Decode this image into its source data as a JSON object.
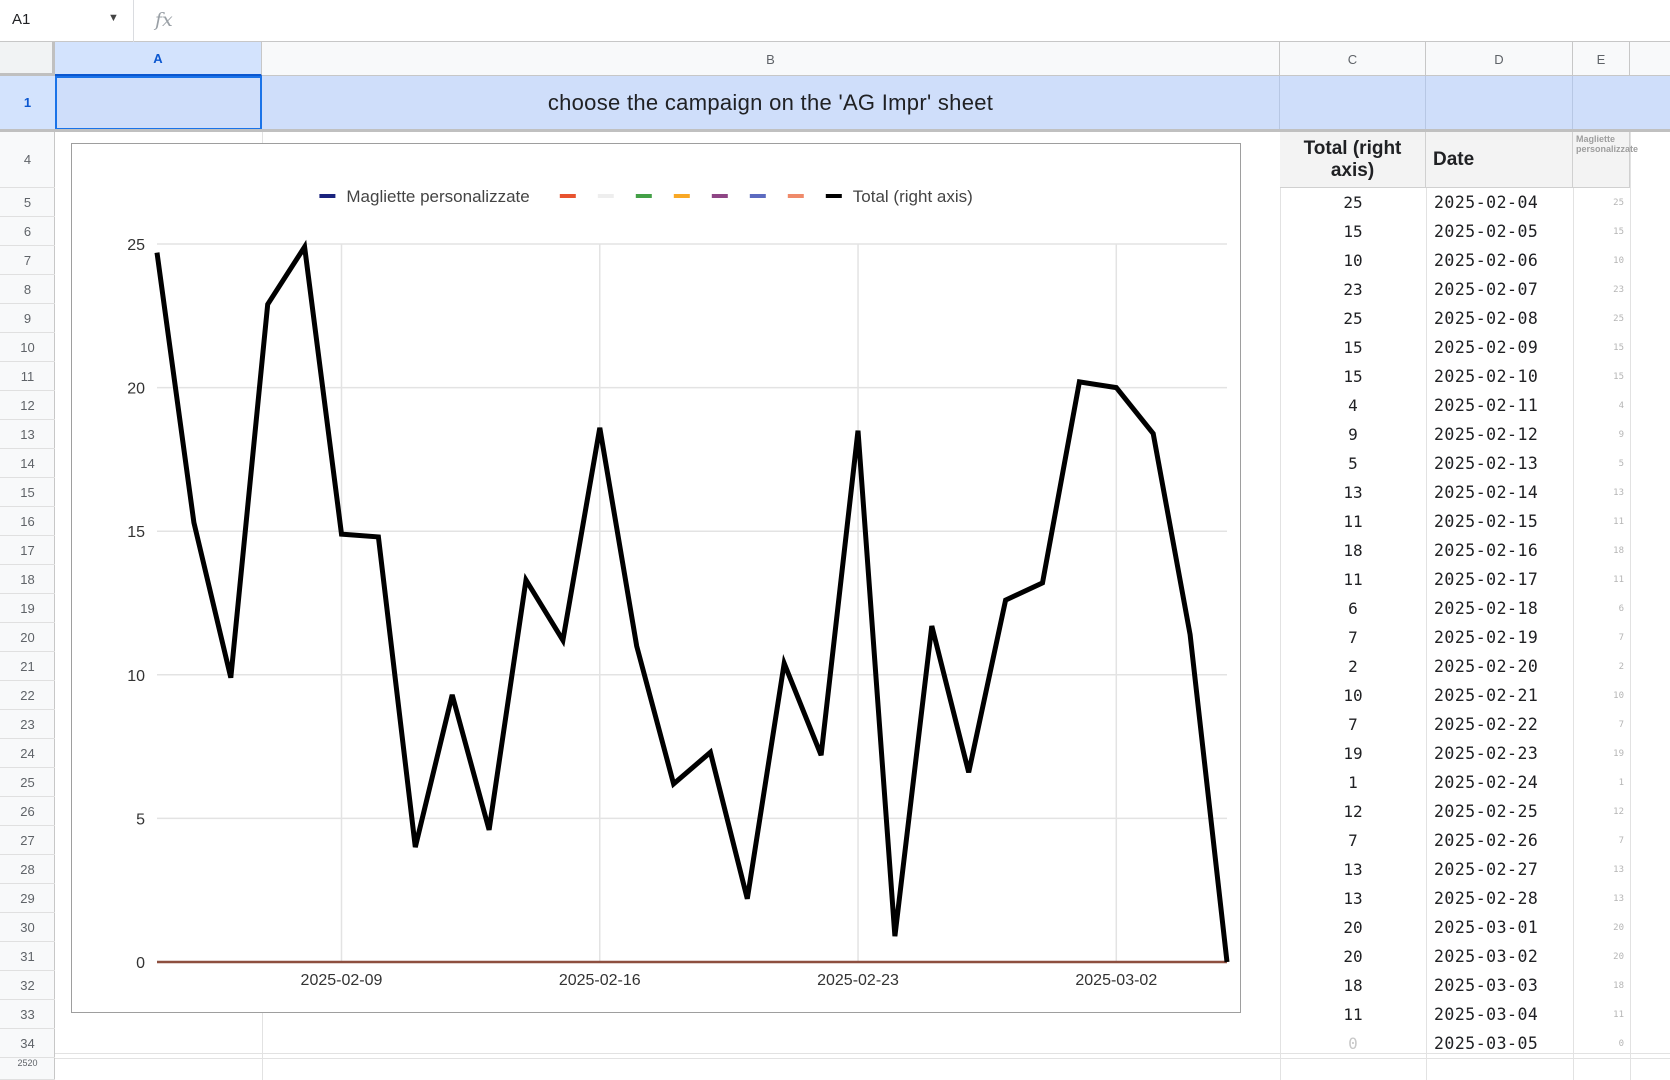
{
  "formula_bar": {
    "cell_ref": "A1",
    "fx": "fx",
    "value": ""
  },
  "columns": [
    "A",
    "B",
    "C",
    "D",
    "E"
  ],
  "rows": [
    "1",
    "4",
    "5",
    "6",
    "7",
    "8",
    "9",
    "10",
    "11",
    "12",
    "13",
    "14",
    "15",
    "16",
    "17",
    "18",
    "19",
    "20",
    "21",
    "22",
    "23",
    "24",
    "25",
    "26",
    "27",
    "28",
    "29",
    "30",
    "31",
    "32",
    "33",
    "34"
  ],
  "row_partial": "2520",
  "banner": "choose the campaign on the 'AG Impr' sheet",
  "headers": {
    "total": "Total (right axis)",
    "date": "Date",
    "magliette": "Magliette personalizzate"
  },
  "table": [
    {
      "total": "25",
      "date": "2025-02-04",
      "small": "25"
    },
    {
      "total": "15",
      "date": "2025-02-05",
      "small": "15"
    },
    {
      "total": "10",
      "date": "2025-02-06",
      "small": "10"
    },
    {
      "total": "23",
      "date": "2025-02-07",
      "small": "23"
    },
    {
      "total": "25",
      "date": "2025-02-08",
      "small": "25"
    },
    {
      "total": "15",
      "date": "2025-02-09",
      "small": "15"
    },
    {
      "total": "15",
      "date": "2025-02-10",
      "small": "15"
    },
    {
      "total": "4",
      "date": "2025-02-11",
      "small": "4"
    },
    {
      "total": "9",
      "date": "2025-02-12",
      "small": "9"
    },
    {
      "total": "5",
      "date": "2025-02-13",
      "small": "5"
    },
    {
      "total": "13",
      "date": "2025-02-14",
      "small": "13"
    },
    {
      "total": "11",
      "date": "2025-02-15",
      "small": "11"
    },
    {
      "total": "18",
      "date": "2025-02-16",
      "small": "18"
    },
    {
      "total": "11",
      "date": "2025-02-17",
      "small": "11"
    },
    {
      "total": "6",
      "date": "2025-02-18",
      "small": "6"
    },
    {
      "total": "7",
      "date": "2025-02-19",
      "small": "7"
    },
    {
      "total": "2",
      "date": "2025-02-20",
      "small": "2"
    },
    {
      "total": "10",
      "date": "2025-02-21",
      "small": "10"
    },
    {
      "total": "7",
      "date": "2025-02-22",
      "small": "7"
    },
    {
      "total": "19",
      "date": "2025-02-23",
      "small": "19"
    },
    {
      "total": "1",
      "date": "2025-02-24",
      "small": "1"
    },
    {
      "total": "12",
      "date": "2025-02-25",
      "small": "12"
    },
    {
      "total": "7",
      "date": "2025-02-26",
      "small": "7"
    },
    {
      "total": "13",
      "date": "2025-02-27",
      "small": "13"
    },
    {
      "total": "13",
      "date": "2025-02-28",
      "small": "13"
    },
    {
      "total": "20",
      "date": "2025-03-01",
      "small": "20"
    },
    {
      "total": "20",
      "date": "2025-03-02",
      "small": "20"
    },
    {
      "total": "18",
      "date": "2025-03-03",
      "small": "18"
    },
    {
      "total": "11",
      "date": "2025-03-04",
      "small": "11"
    },
    {
      "total": "0",
      "date": "2025-03-05",
      "small": "0"
    }
  ],
  "chart_data": {
    "type": "line",
    "legend": {
      "position": "top",
      "items": [
        {
          "name": "Magliette personalizzate",
          "color": "#1a237e"
        },
        {
          "name": "",
          "color": "#e8532f"
        },
        {
          "name": "",
          "color": "#eeeeee"
        },
        {
          "name": "",
          "color": "#43a047"
        },
        {
          "name": "",
          "color": "#f9a825"
        },
        {
          "name": "",
          "color": "#8e4585"
        },
        {
          "name": "",
          "color": "#5c6bc0"
        },
        {
          "name": "",
          "color": "#ef8a6a"
        },
        {
          "name": "Total (right axis)",
          "color": "#000000"
        }
      ]
    },
    "x": [
      "2025-02-04",
      "2025-02-05",
      "2025-02-06",
      "2025-02-07",
      "2025-02-08",
      "2025-02-09",
      "2025-02-10",
      "2025-02-11",
      "2025-02-12",
      "2025-02-13",
      "2025-02-14",
      "2025-02-15",
      "2025-02-16",
      "2025-02-17",
      "2025-02-18",
      "2025-02-19",
      "2025-02-20",
      "2025-02-21",
      "2025-02-22",
      "2025-02-23",
      "2025-02-24",
      "2025-02-25",
      "2025-02-26",
      "2025-02-27",
      "2025-02-28",
      "2025-03-01",
      "2025-03-02",
      "2025-03-03",
      "2025-03-04",
      "2025-03-05"
    ],
    "series": [
      {
        "name": "Total (right axis)",
        "color": "#000000",
        "values": [
          24.7,
          15.3,
          9.9,
          22.9,
          24.9,
          14.9,
          14.8,
          4,
          9.3,
          4.6,
          13.3,
          11.2,
          18.6,
          11,
          6.2,
          7.3,
          2.2,
          10.4,
          7.2,
          18.5,
          0.9,
          11.7,
          6.6,
          12.6,
          13.2,
          20.2,
          20,
          18.4,
          11.4,
          0
        ]
      },
      {
        "name": "Magliette personalizzate",
        "color": "#8d4f3f",
        "values": [
          0,
          0,
          0,
          0,
          0,
          0,
          0,
          0,
          0,
          0,
          0,
          0,
          0,
          0,
          0,
          0,
          0,
          0,
          0,
          0,
          0,
          0,
          0,
          0,
          0,
          0,
          0,
          0,
          0,
          0
        ]
      }
    ],
    "x_ticks": [
      "2025-02-09",
      "2025-02-16",
      "2025-02-23",
      "2025-03-02"
    ],
    "y_ticks": [
      0,
      5,
      10,
      15,
      20,
      25
    ],
    "ylim": [
      0,
      25
    ],
    "grid": true
  }
}
